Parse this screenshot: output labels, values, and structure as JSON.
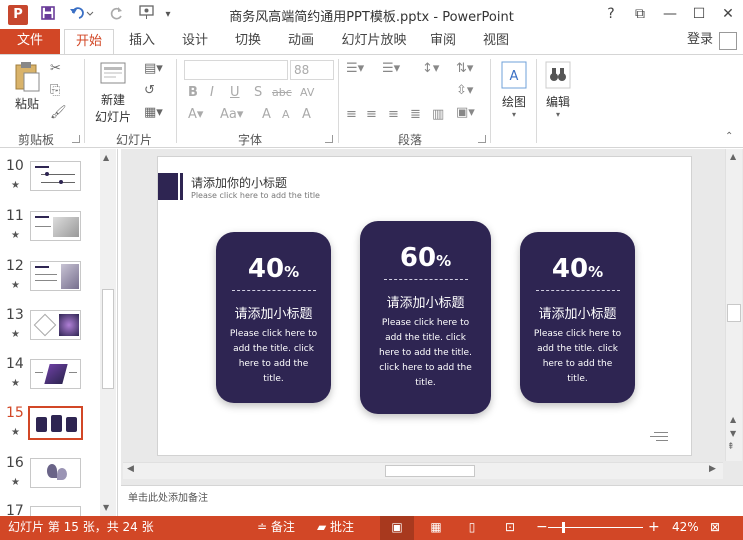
{
  "window": {
    "title": "商务风高端简约通用PPT模板.pptx - PowerPoint",
    "app_icon": "P",
    "help": "?",
    "restore": "⧉",
    "minimize": "—",
    "maximize": "☐",
    "close": "✕"
  },
  "tabs": {
    "file": "文件",
    "items": [
      "开始",
      "插入",
      "设计",
      "切换",
      "动画",
      "幻灯片放映",
      "审阅",
      "视图"
    ],
    "login": "登录"
  },
  "ribbon": {
    "paste_label": "粘贴",
    "clipboard_group": "剪贴板",
    "new_slide_label_1": "新建",
    "new_slide_label_2": "幻灯片",
    "slides_group": "幻灯片",
    "font_size": "88",
    "font_group": "字体",
    "paragraph_group": "段落",
    "drawing_label": "绘图",
    "editing_label": "编辑"
  },
  "thumbnails": [
    {
      "num": "10",
      "star": "★"
    },
    {
      "num": "11",
      "star": "★"
    },
    {
      "num": "12",
      "star": "★"
    },
    {
      "num": "13",
      "star": "★"
    },
    {
      "num": "14",
      "star": "★"
    },
    {
      "num": "15",
      "star": "★",
      "selected": true
    },
    {
      "num": "16",
      "star": "★"
    },
    {
      "num": "17",
      "star": "★"
    }
  ],
  "slide": {
    "header_title": "请添加你的小标题",
    "header_sub": "Please click here to add the title",
    "cards": [
      {
        "value": "40",
        "unit": "%",
        "title": "请添加小标题",
        "body": "Please click here to add the title.  click here to add the title."
      },
      {
        "value": "60",
        "unit": "%",
        "title": "请添加小标题",
        "body": "Please click here to add the title.  click here to add the title. click here to add the title."
      },
      {
        "value": "40",
        "unit": "%",
        "title": "请添加小标题",
        "body": "Please click here to add the title.  click here to add the title."
      }
    ]
  },
  "notes_placeholder": "单击此处添加备注",
  "status": {
    "slide_info": "幻灯片 第 15 张，共 24 张",
    "notes": "备注",
    "comments": "批注",
    "zoom": "42%"
  },
  "colors": {
    "accent": "#d24726",
    "card": "#2e2552"
  }
}
